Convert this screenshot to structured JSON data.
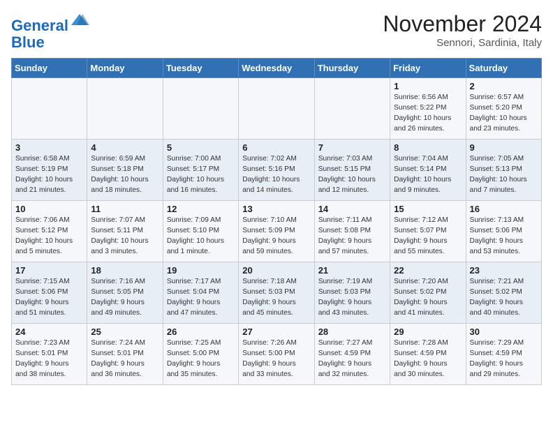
{
  "header": {
    "logo_line1": "General",
    "logo_line2": "Blue",
    "month": "November 2024",
    "location": "Sennori, Sardinia, Italy"
  },
  "weekdays": [
    "Sunday",
    "Monday",
    "Tuesday",
    "Wednesday",
    "Thursday",
    "Friday",
    "Saturday"
  ],
  "weeks": [
    [
      {
        "day": "",
        "info": ""
      },
      {
        "day": "",
        "info": ""
      },
      {
        "day": "",
        "info": ""
      },
      {
        "day": "",
        "info": ""
      },
      {
        "day": "",
        "info": ""
      },
      {
        "day": "1",
        "info": "Sunrise: 6:56 AM\nSunset: 5:22 PM\nDaylight: 10 hours\nand 26 minutes."
      },
      {
        "day": "2",
        "info": "Sunrise: 6:57 AM\nSunset: 5:20 PM\nDaylight: 10 hours\nand 23 minutes."
      }
    ],
    [
      {
        "day": "3",
        "info": "Sunrise: 6:58 AM\nSunset: 5:19 PM\nDaylight: 10 hours\nand 21 minutes."
      },
      {
        "day": "4",
        "info": "Sunrise: 6:59 AM\nSunset: 5:18 PM\nDaylight: 10 hours\nand 18 minutes."
      },
      {
        "day": "5",
        "info": "Sunrise: 7:00 AM\nSunset: 5:17 PM\nDaylight: 10 hours\nand 16 minutes."
      },
      {
        "day": "6",
        "info": "Sunrise: 7:02 AM\nSunset: 5:16 PM\nDaylight: 10 hours\nand 14 minutes."
      },
      {
        "day": "7",
        "info": "Sunrise: 7:03 AM\nSunset: 5:15 PM\nDaylight: 10 hours\nand 12 minutes."
      },
      {
        "day": "8",
        "info": "Sunrise: 7:04 AM\nSunset: 5:14 PM\nDaylight: 10 hours\nand 9 minutes."
      },
      {
        "day": "9",
        "info": "Sunrise: 7:05 AM\nSunset: 5:13 PM\nDaylight: 10 hours\nand 7 minutes."
      }
    ],
    [
      {
        "day": "10",
        "info": "Sunrise: 7:06 AM\nSunset: 5:12 PM\nDaylight: 10 hours\nand 5 minutes."
      },
      {
        "day": "11",
        "info": "Sunrise: 7:07 AM\nSunset: 5:11 PM\nDaylight: 10 hours\nand 3 minutes."
      },
      {
        "day": "12",
        "info": "Sunrise: 7:09 AM\nSunset: 5:10 PM\nDaylight: 10 hours\nand 1 minute."
      },
      {
        "day": "13",
        "info": "Sunrise: 7:10 AM\nSunset: 5:09 PM\nDaylight: 9 hours\nand 59 minutes."
      },
      {
        "day": "14",
        "info": "Sunrise: 7:11 AM\nSunset: 5:08 PM\nDaylight: 9 hours\nand 57 minutes."
      },
      {
        "day": "15",
        "info": "Sunrise: 7:12 AM\nSunset: 5:07 PM\nDaylight: 9 hours\nand 55 minutes."
      },
      {
        "day": "16",
        "info": "Sunrise: 7:13 AM\nSunset: 5:06 PM\nDaylight: 9 hours\nand 53 minutes."
      }
    ],
    [
      {
        "day": "17",
        "info": "Sunrise: 7:15 AM\nSunset: 5:06 PM\nDaylight: 9 hours\nand 51 minutes."
      },
      {
        "day": "18",
        "info": "Sunrise: 7:16 AM\nSunset: 5:05 PM\nDaylight: 9 hours\nand 49 minutes."
      },
      {
        "day": "19",
        "info": "Sunrise: 7:17 AM\nSunset: 5:04 PM\nDaylight: 9 hours\nand 47 minutes."
      },
      {
        "day": "20",
        "info": "Sunrise: 7:18 AM\nSunset: 5:03 PM\nDaylight: 9 hours\nand 45 minutes."
      },
      {
        "day": "21",
        "info": "Sunrise: 7:19 AM\nSunset: 5:03 PM\nDaylight: 9 hours\nand 43 minutes."
      },
      {
        "day": "22",
        "info": "Sunrise: 7:20 AM\nSunset: 5:02 PM\nDaylight: 9 hours\nand 41 minutes."
      },
      {
        "day": "23",
        "info": "Sunrise: 7:21 AM\nSunset: 5:02 PM\nDaylight: 9 hours\nand 40 minutes."
      }
    ],
    [
      {
        "day": "24",
        "info": "Sunrise: 7:23 AM\nSunset: 5:01 PM\nDaylight: 9 hours\nand 38 minutes."
      },
      {
        "day": "25",
        "info": "Sunrise: 7:24 AM\nSunset: 5:01 PM\nDaylight: 9 hours\nand 36 minutes."
      },
      {
        "day": "26",
        "info": "Sunrise: 7:25 AM\nSunset: 5:00 PM\nDaylight: 9 hours\nand 35 minutes."
      },
      {
        "day": "27",
        "info": "Sunrise: 7:26 AM\nSunset: 5:00 PM\nDaylight: 9 hours\nand 33 minutes."
      },
      {
        "day": "28",
        "info": "Sunrise: 7:27 AM\nSunset: 4:59 PM\nDaylight: 9 hours\nand 32 minutes."
      },
      {
        "day": "29",
        "info": "Sunrise: 7:28 AM\nSunset: 4:59 PM\nDaylight: 9 hours\nand 30 minutes."
      },
      {
        "day": "30",
        "info": "Sunrise: 7:29 AM\nSunset: 4:59 PM\nDaylight: 9 hours\nand 29 minutes."
      }
    ]
  ]
}
